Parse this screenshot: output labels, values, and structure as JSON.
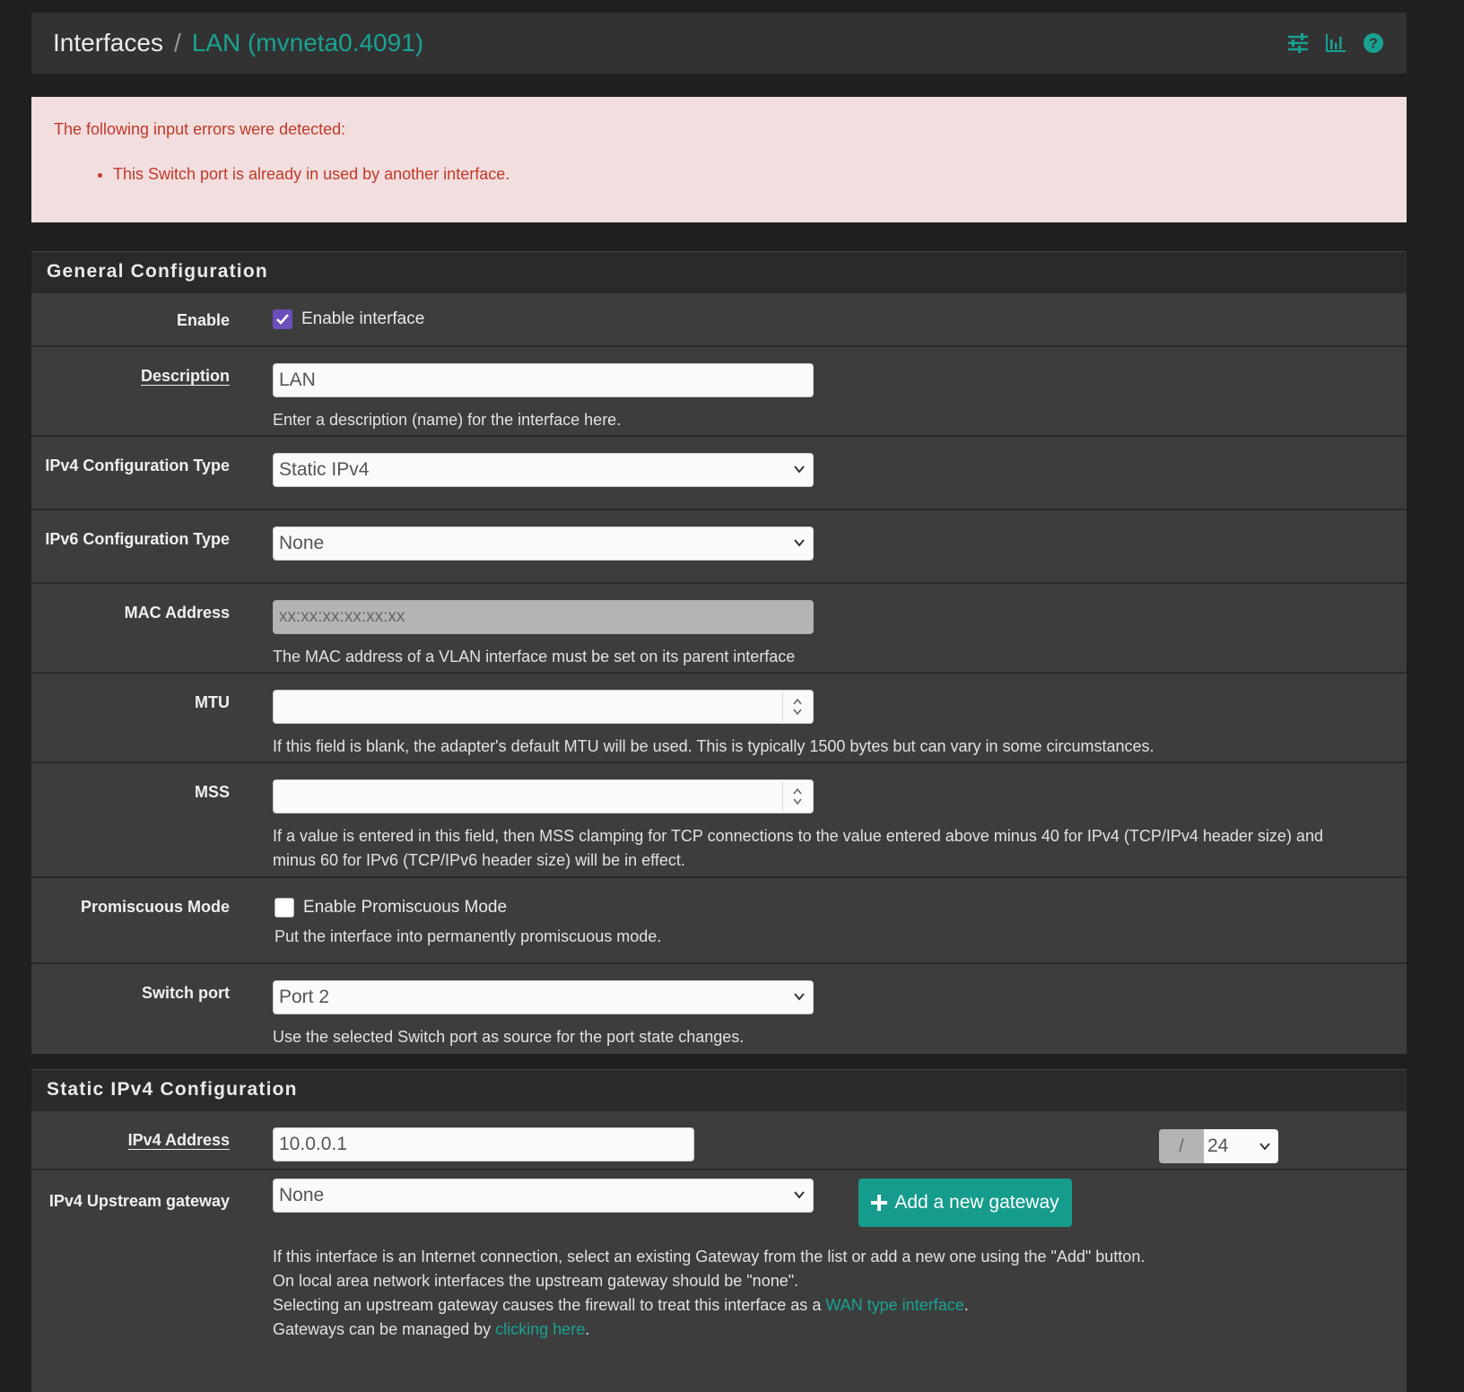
{
  "breadcrumb": {
    "root": "Interfaces",
    "separator": "/",
    "current": "LAN (mvneta0.4091)"
  },
  "header_icons": [
    "sliders-icon",
    "bar-chart-icon",
    "help-icon"
  ],
  "alert": {
    "heading": "The following input errors were detected:",
    "errors": [
      "This Switch port is already in used by another interface."
    ]
  },
  "general": {
    "title": "General Configuration",
    "enable": {
      "label": "Enable",
      "checkbox_label": "Enable interface",
      "checked": true
    },
    "description": {
      "label": "Description",
      "value": "LAN",
      "help": "Enter a description (name) for the interface here."
    },
    "ipv4_type": {
      "label": "IPv4 Configuration Type",
      "value": "Static IPv4"
    },
    "ipv6_type": {
      "label": "IPv6 Configuration Type",
      "value": "None"
    },
    "mac": {
      "label": "MAC Address",
      "placeholder": "xx:xx:xx:xx:xx:xx",
      "help": "The MAC address of a VLAN interface must be set on its parent interface"
    },
    "mtu": {
      "label": "MTU",
      "value": "",
      "help": "If this field is blank, the adapter's default MTU will be used. This is typically 1500 bytes but can vary in some circumstances."
    },
    "mss": {
      "label": "MSS",
      "value": "",
      "help": "If a value is entered in this field, then MSS clamping for TCP connections to the value entered above minus 40 for IPv4 (TCP/IPv4 header size) and minus 60 for IPv6 (TCP/IPv6 header size) will be in effect."
    },
    "promisc": {
      "label": "Promiscuous Mode",
      "checkbox_label": "Enable Promiscuous Mode",
      "checked": false,
      "help": "Put the interface into permanently promiscuous mode."
    },
    "switch_port": {
      "label": "Switch port",
      "value": "Port 2",
      "help": "Use the selected Switch port as source for the port state changes."
    }
  },
  "static_ipv4": {
    "title": "Static IPv4 Configuration",
    "address": {
      "label": "IPv4 Address",
      "value": "10.0.0.1",
      "slash": "/",
      "cidr": "24"
    },
    "gateway": {
      "label": "IPv4 Upstream gateway",
      "value": "None",
      "add_button": "Add a new gateway",
      "help_line1": "If this interface is an Internet connection, select an existing Gateway from the list or add a new one using the \"Add\" button.",
      "help_line2": "On local area network interfaces the upstream gateway should be \"none\".",
      "help_line3_pre": "Selecting an upstream gateway causes the firewall to treat this interface as a ",
      "help_line3_link": "WAN type interface",
      "help_line3_post": ".",
      "help_line4_pre": "Gateways can be managed by ",
      "help_line4_link": "clicking here",
      "help_line4_post": "."
    }
  },
  "colors": {
    "accent": "#19a292",
    "button": "#169c8c",
    "alert_bg": "#f2dede",
    "alert_text": "#c0392b",
    "checkbox": "#6b4fbb"
  }
}
